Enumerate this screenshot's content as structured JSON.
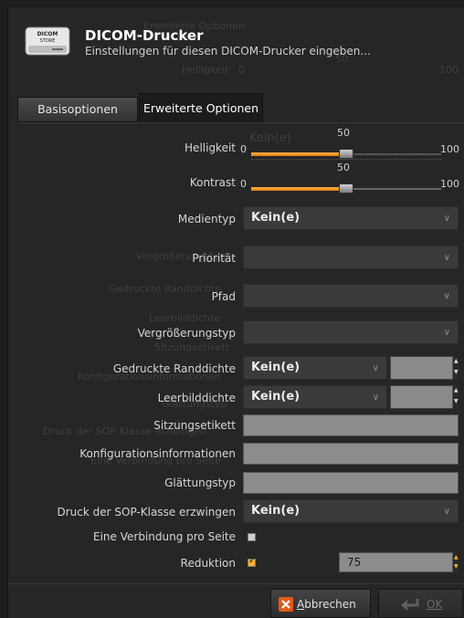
{
  "header": {
    "title": "DICOM-Drucker",
    "subtitle": "Einstellungen für diesen DICOM-Drucker eingeben...",
    "icon_text_top": "DICOM",
    "icon_text_bottom": "STORE"
  },
  "tabs": [
    {
      "label": "Basisoptionen",
      "active": false
    },
    {
      "label": "Erweiterte Optionen",
      "active": true
    }
  ],
  "ghost": {
    "tab_text": "Erweiterte Optionen",
    "helligkeit": "Helligkeit",
    "slider_min": "0",
    "slider_mid": "50",
    "slider_max": "100",
    "medientyp_val": "Kein(e)",
    "vergroesserung": "Vergrößerungstyp",
    "randdichte": "Gedruckte Randdichte",
    "leerbild": "Leerbilddichte",
    "sitzung": "Sitzungsetikett",
    "konfig": "Konfigurationsinformationen",
    "glaettung": "Glättungstyp",
    "sop": "Druck der SOP-Klasse erzwingen",
    "verbindung": "Eine Verbindung pro Seite"
  },
  "fields": {
    "helligkeit": {
      "label": "Helligkeit",
      "min": "0",
      "max": "100",
      "value_label": "50",
      "value": 50
    },
    "kontrast": {
      "label": "Kontrast",
      "min": "0",
      "max": "100",
      "value_label": "50",
      "value": 50
    },
    "medientyp": {
      "label": "Medientyp",
      "value": "Kein(e)"
    },
    "prioritaet": {
      "label": "Priorität",
      "value": ""
    },
    "pfad": {
      "label": "Pfad",
      "value": ""
    },
    "vergroesserungstyp": {
      "label": "Vergrößerungstyp",
      "value": ""
    },
    "randdichte": {
      "label": "Gedruckte Randdichte",
      "value": "Kein(e)",
      "spin_value": ""
    },
    "leerbilddichte": {
      "label": "Leerbilddichte",
      "value": "Kein(e)",
      "spin_value": ""
    },
    "sitzungsetikett": {
      "label": "Sitzungsetikett",
      "value": ""
    },
    "konfiguration": {
      "label": "Konfigurationsinformationen",
      "value": ""
    },
    "glaettungstyp": {
      "label": "Glättungstyp",
      "value": ""
    },
    "sop_klasse": {
      "label": "Druck der SOP-Klasse erzwingen",
      "value": "Kein(e)"
    },
    "verbindung": {
      "label": "Eine Verbindung pro Seite",
      "checked": false
    },
    "reduktion": {
      "label": "Reduktion",
      "checked": true,
      "value": "75"
    }
  },
  "buttons": {
    "cancel_label_u": "A",
    "cancel_label_rest": "bbrechen",
    "ok_label": "OK"
  },
  "colors": {
    "accent": "#ffb030",
    "cancel_icon": "#e05a1c"
  },
  "icons": {
    "header": "dicom-store-printer-icon",
    "combo_arrow": "chevron-down-icon",
    "cancel": "close-icon",
    "ok": "enter-arrow-icon"
  }
}
